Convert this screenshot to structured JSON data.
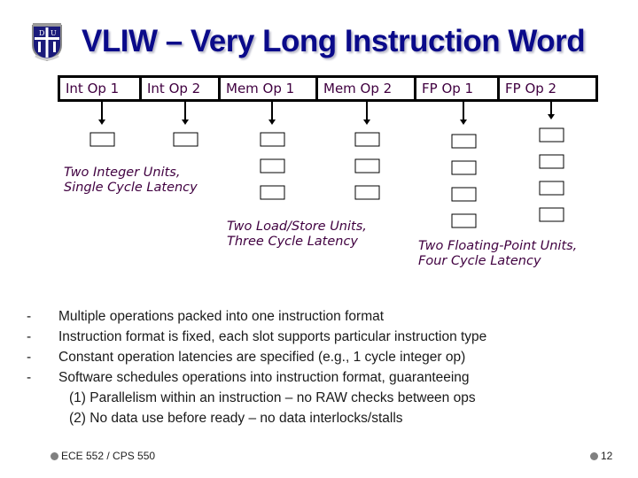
{
  "title": "VLIW – Very Long Instruction Word",
  "logo": {
    "icon": "university-crest-icon",
    "colors": {
      "shield": "#1a1a7a",
      "border": "#8a8a8a"
    }
  },
  "instruction_word": {
    "slots": [
      {
        "label": "Int Op 1",
        "unit_latency": 1
      },
      {
        "label": "Int Op 2",
        "unit_latency": 1
      },
      {
        "label": "Mem Op 1",
        "unit_latency": 3
      },
      {
        "label": "Mem Op 2",
        "unit_latency": 3
      },
      {
        "label": "FP Op 1",
        "unit_latency": 4
      },
      {
        "label": "FP Op 2",
        "unit_latency": 4
      }
    ]
  },
  "captions": {
    "integer": {
      "line1": "Two Integer Units,",
      "line2": "Single Cycle Latency"
    },
    "loadstore": {
      "line1": "Two Load/Store Units,",
      "line2": "Three Cycle Latency"
    },
    "fp": {
      "line1": "Two Floating-Point Units,",
      "line2": "Four Cycle Latency"
    }
  },
  "bullets": {
    "marker": "-",
    "items": [
      "Multiple operations packed into one instruction format",
      "Instruction format is fixed, each slot supports particular instruction type",
      "Constant operation latencies are specified (e.g., 1 cycle integer op)",
      "Software schedules operations into instruction format, guaranteeing"
    ],
    "subitems": [
      "(1) Parallelism within an instruction – no RAW checks between ops",
      "(2) No data use before ready – no data interlocks/stalls"
    ]
  },
  "footer": {
    "course": "ECE 552 / CPS 550",
    "page": "12"
  },
  "colors": {
    "title": "#0a0a8a",
    "slot_text": "#400040",
    "caption_text": "#400040",
    "footer_dot": "#808080"
  }
}
